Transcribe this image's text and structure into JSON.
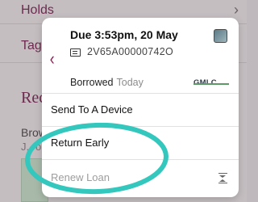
{
  "background": {
    "holds_label": "Holds",
    "tags_label": "Tags",
    "section_heading": "Rec",
    "item_title": "Brow",
    "item_subtitle": "J. ro"
  },
  "popover": {
    "due": "Due 3:53pm, 20 May",
    "barcode": "2V65A00000742O",
    "status": "Borrowed",
    "status_time": "Today",
    "logo_text": "GMLC",
    "menu": {
      "send": "Send To A Device",
      "return": "Return Early",
      "renew": "Renew Loan"
    }
  },
  "icons": {
    "chevron_right": "chevron-right-icon",
    "back": "chevron-left-icon",
    "barcode": "barcode-icon",
    "hourglass": "hourglass-icon"
  },
  "colors": {
    "brand": "#8c1b52",
    "highlight": "#33c7bd",
    "disabled_text": "#9d9d9d"
  }
}
